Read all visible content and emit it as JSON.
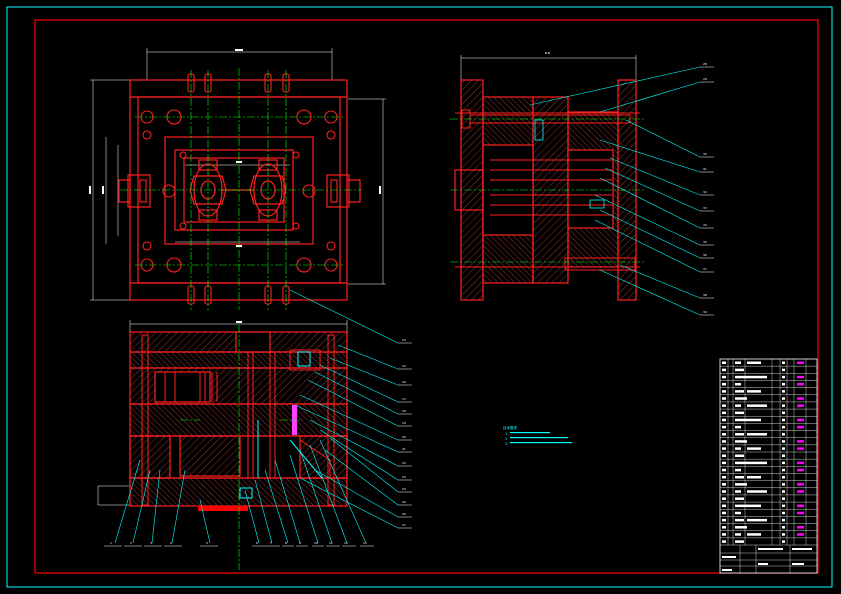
{
  "colors": {
    "background": "#000000",
    "frame": "#00ffff",
    "border": "#ff0000",
    "outline": "#ff2020",
    "centerline": "#00ff00",
    "leader": "#00ffff",
    "hatch": "#ff5050",
    "dimension": "#ffffff",
    "accent": "#ff00ff",
    "table_cell": "#ffffff"
  },
  "views": {
    "top_plan": "plan-view",
    "front_section": "front-section-view",
    "side_section": "side-section-view"
  },
  "section_mark": "B-B",
  "tech_notes": {
    "title": "技术要求",
    "lines": [
      "1.",
      "2.",
      "3."
    ]
  },
  "balloons_front": [
    "1",
    "2",
    "3",
    "4",
    "5",
    "6",
    "7",
    "8",
    "9",
    "10",
    "11",
    "12",
    "13"
  ],
  "balloons_right_front": [
    "14",
    "15",
    "16",
    "17",
    "18",
    "19",
    "20",
    "21",
    "22",
    "23",
    "24",
    "25",
    "26",
    "27"
  ],
  "balloons_side": [
    "28",
    "29",
    "30",
    "31",
    "32",
    "33",
    "34",
    "35",
    "36",
    "37",
    "38",
    "39"
  ],
  "title_block": {
    "drawing_title": "",
    "rows": 26
  }
}
